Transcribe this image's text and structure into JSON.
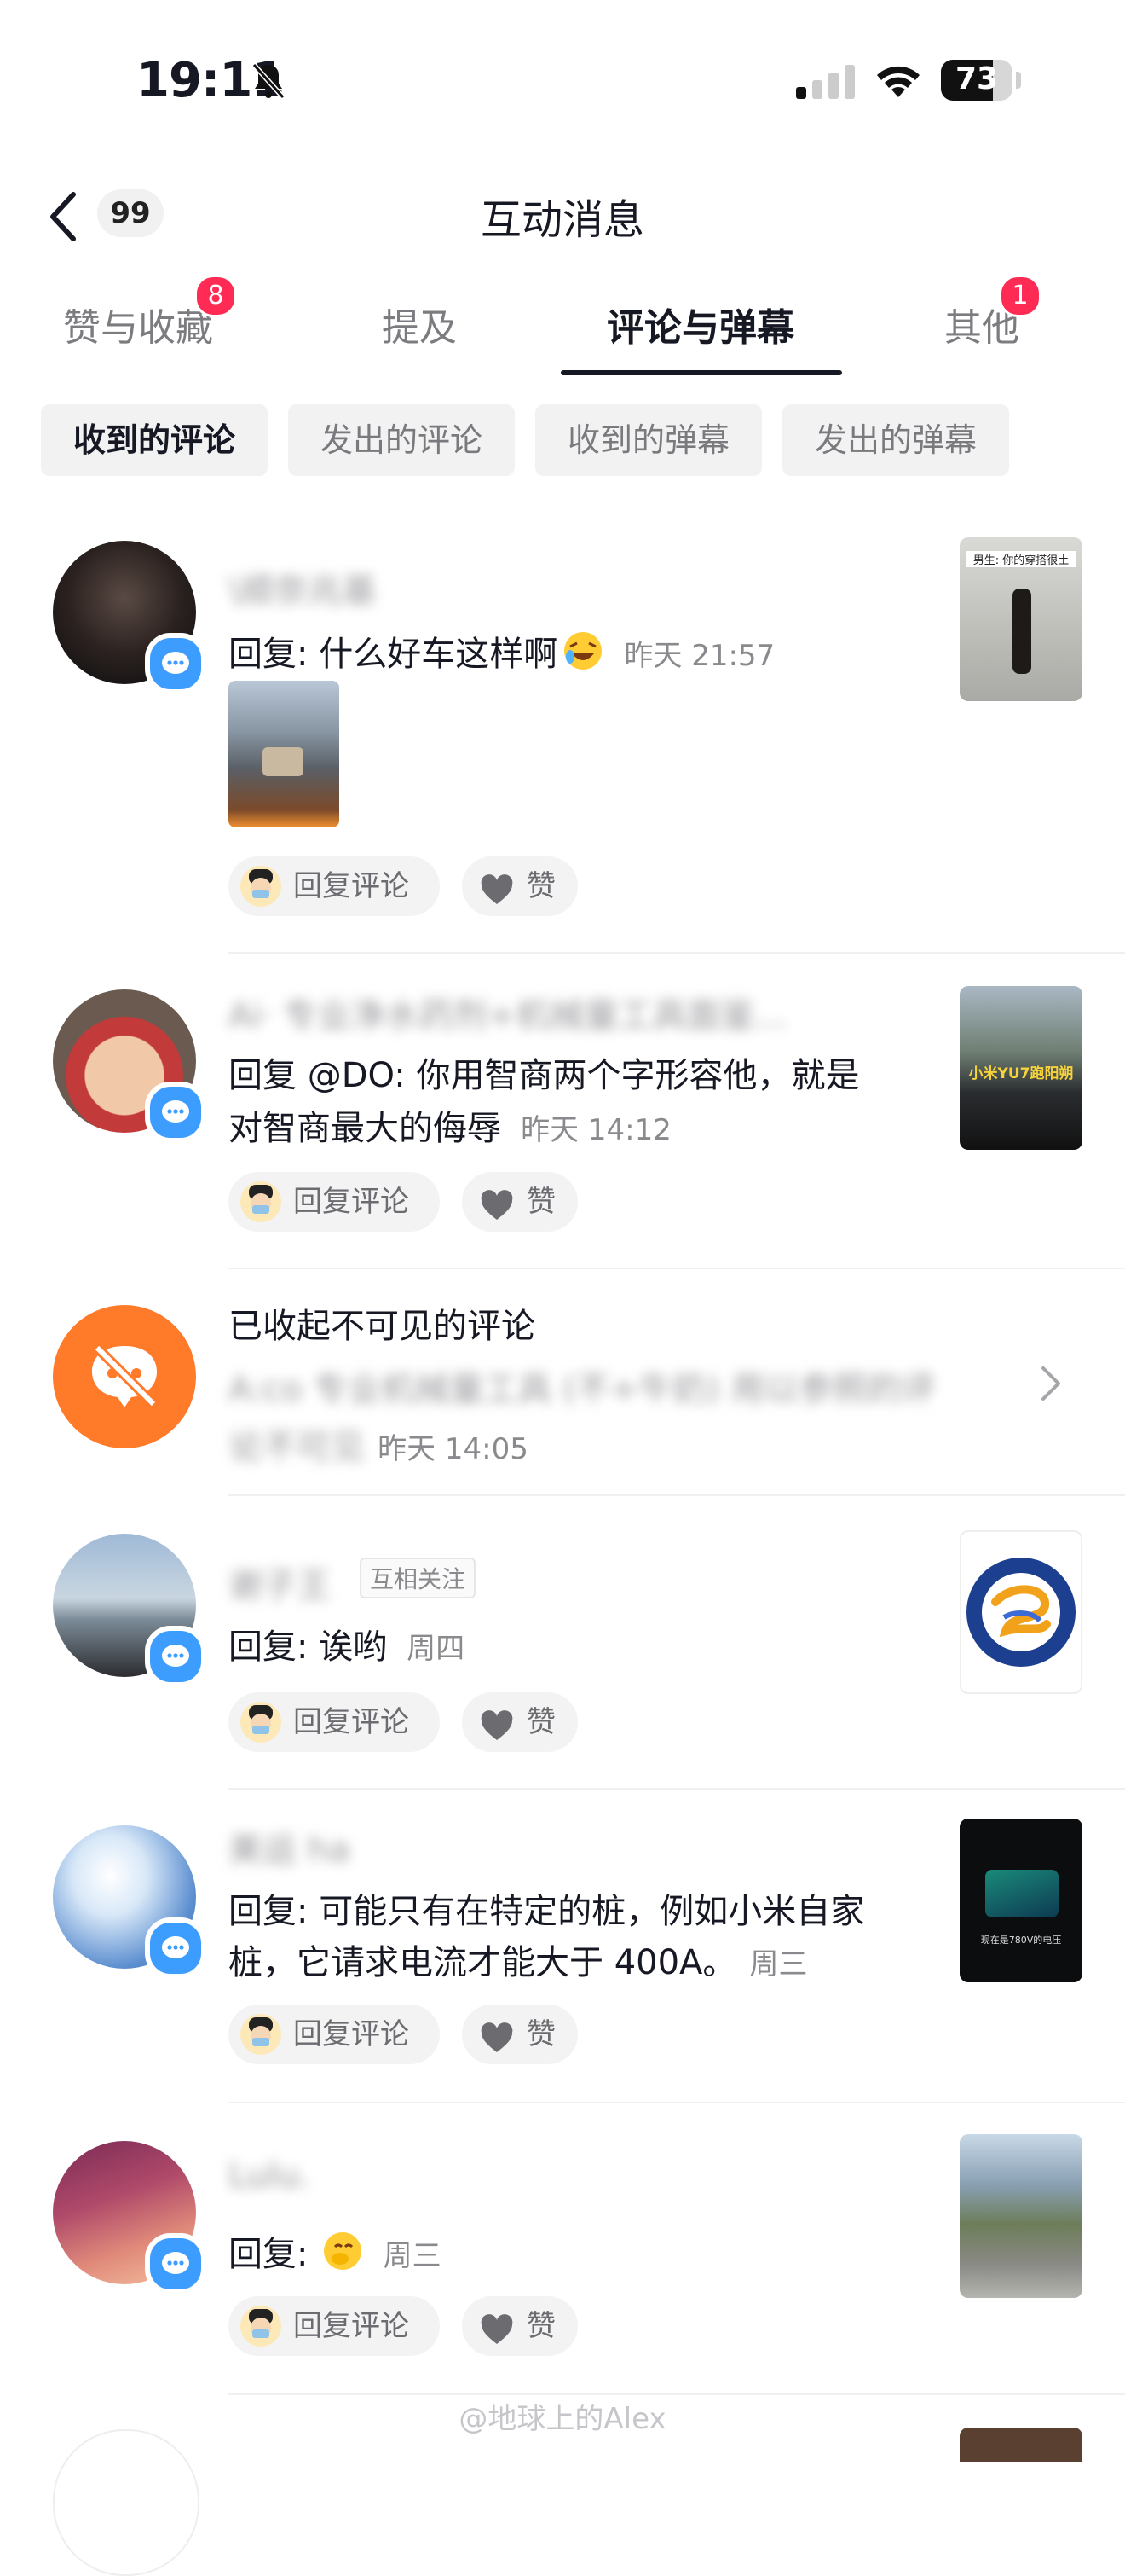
{
  "status_bar": {
    "time": "19:11",
    "battery": "73",
    "battery_level": 0.73
  },
  "header": {
    "back_count": "99",
    "title": "互动消息"
  },
  "tabs": [
    {
      "label": "赞与收藏",
      "badge": "8"
    },
    {
      "label": "提及",
      "badge": ""
    },
    {
      "label": "评论与弹幕",
      "badge": ""
    },
    {
      "label": "其他",
      "badge": "1"
    }
  ],
  "filters": [
    "收到的评论",
    "发出的评论",
    "收到的弹幕",
    "发出的弹幕"
  ],
  "actions": {
    "reply": "回复评论",
    "like": "赞"
  },
  "items": [
    {
      "name": "\\顺奈兆基",
      "line1": "回复: 什么好车这样啊",
      "time": "昨天 21:57",
      "thumb_caption": "男生: 你的穿搭很土"
    },
    {
      "name": "Ai· 专业净水药剂+机械量工具面鉴...",
      "line1": "回复 @DO: 你用智商两个字形容他，就是",
      "line2": "对智商最大的侮辱",
      "time": "昨天 14:12",
      "thumb_caption": "小米YU7跑阳朔"
    },
    {
      "title": "已收起不可见的评论",
      "line1": "A:co 专业机械量工具 (不+牛奶) 用以参照的评",
      "line2": "论不可见",
      "time": "昨天 14:05"
    },
    {
      "name": "谢子王",
      "tag": "互相关注",
      "line1": "回复: 诶哟",
      "time": "周四"
    },
    {
      "name": "美运 ha",
      "line1": "回复: 可能只有在特定的桩，例如小米自家",
      "line2": "桩，它请求电流才能大于 400A。",
      "time": "周三",
      "thumb_caption": "现在是780V的电压"
    },
    {
      "name": "Lulu.",
      "line1": "回复:",
      "time": "周三"
    }
  ],
  "watermark": "@地球上的Alex",
  "colors": {
    "accent_red": "#fe2c55",
    "comment_badge": "#3d9dff",
    "hidden_icon": "#ff7a29"
  }
}
